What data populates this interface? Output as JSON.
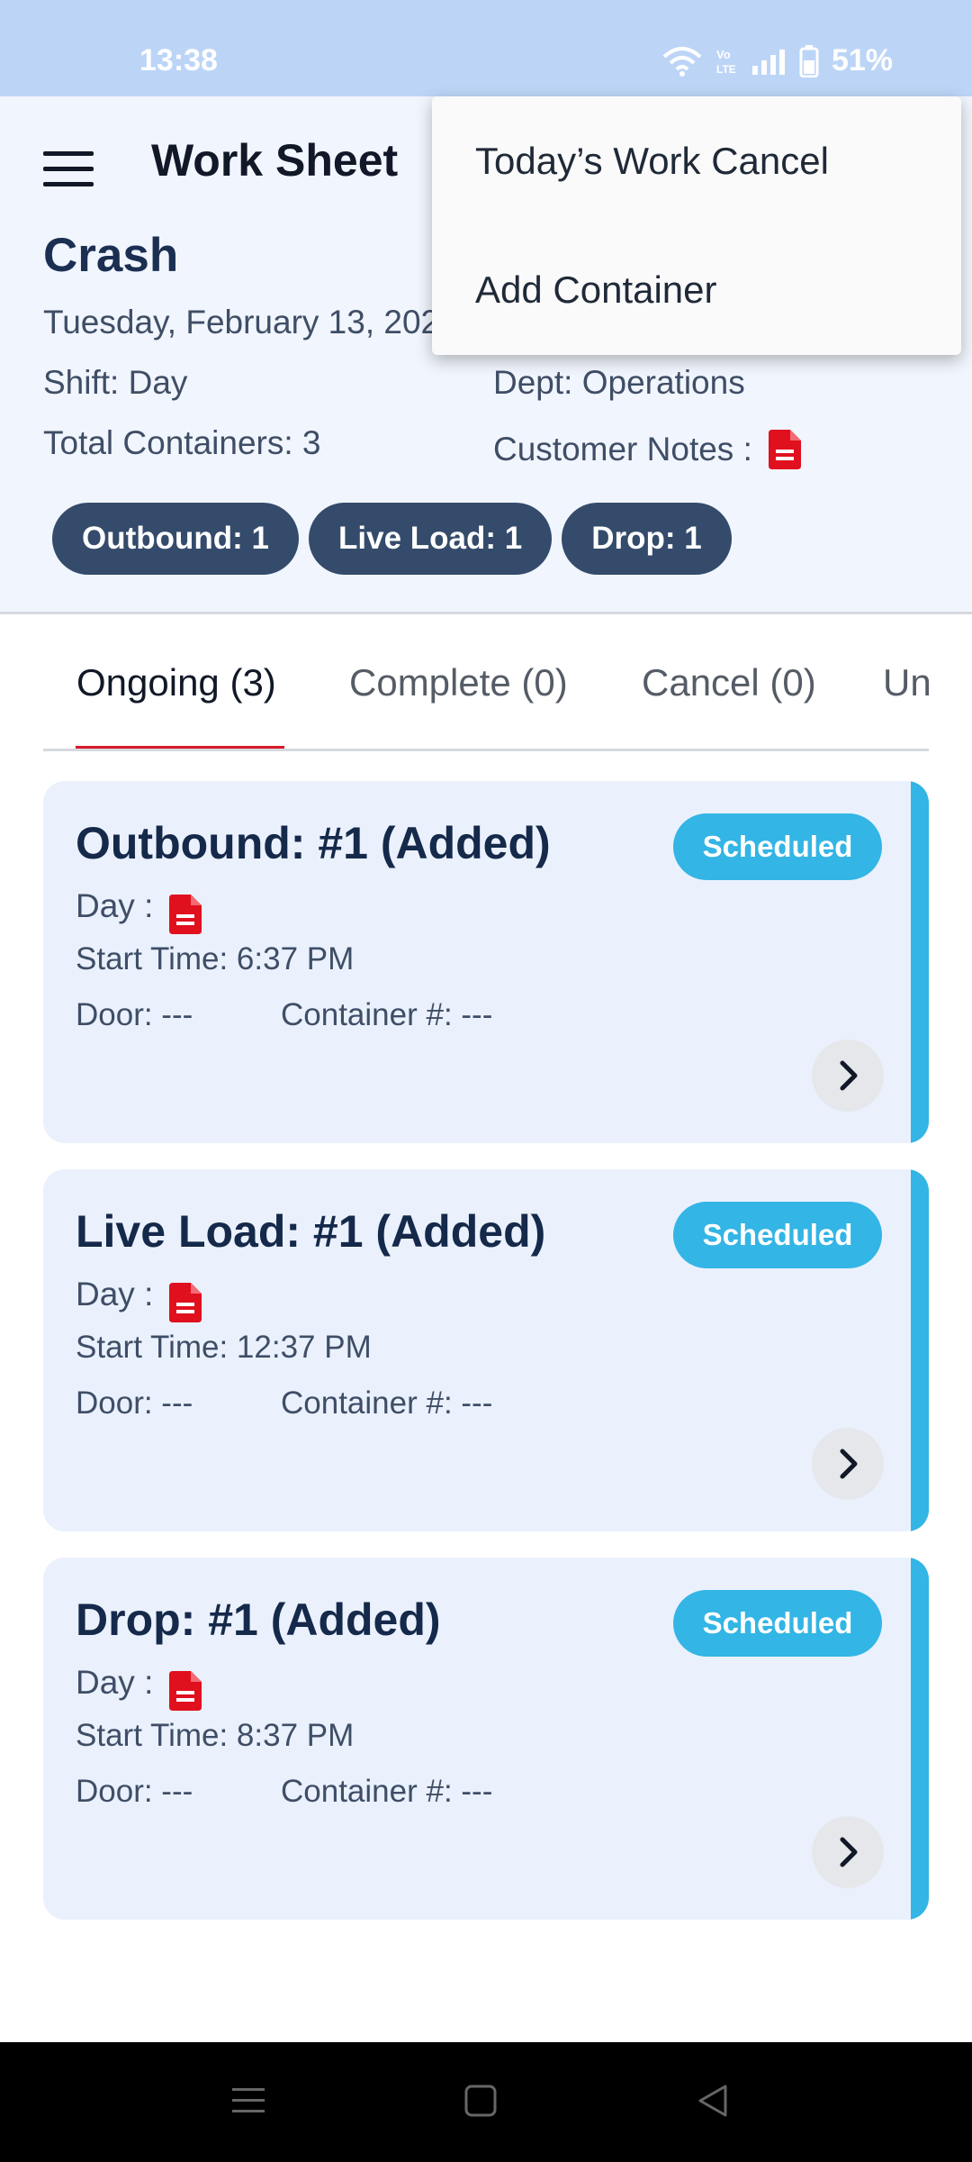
{
  "status_bar": {
    "time": "13:38",
    "battery": "51%",
    "icons": [
      "wifi-icon",
      "volte-icon",
      "signal-icon",
      "battery-icon"
    ]
  },
  "header": {
    "title": "Work Sheet",
    "menu_icon": "hamburger-menu-icon"
  },
  "dropdown": {
    "items": [
      {
        "label": "Today’s Work Cancel"
      },
      {
        "label": "Add Container"
      }
    ]
  },
  "summary": {
    "name": "Crash",
    "date": "Tuesday, February 13, 202",
    "shift": "Shift: Day",
    "total_containers": "Total Containers: 3",
    "dept": "Dept: Operations",
    "customer_notes_label": "Customer Notes :",
    "chips": [
      {
        "label": "Outbound: 1"
      },
      {
        "label": "Live Load: 1"
      },
      {
        "label": "Drop: 1"
      }
    ]
  },
  "tabs": [
    {
      "label": "Ongoing (3)"
    },
    {
      "label": "Complete (0)"
    },
    {
      "label": "Cancel (0)"
    },
    {
      "label": "Un"
    }
  ],
  "cards": [
    {
      "title": "Outbound: #1 (Added)",
      "status": "Scheduled",
      "day_label": "Day :",
      "start_time": "Start Time: 6:37 PM",
      "door": "Door: ---",
      "container": "Container #: ---"
    },
    {
      "title": "Live Load: #1 (Added)",
      "status": "Scheduled",
      "day_label": "Day :",
      "start_time": "Start Time: 12:37 PM",
      "door": "Door: ---",
      "container": "Container #: ---"
    },
    {
      "title": "Drop: #1 (Added)",
      "status": "Scheduled",
      "day_label": "Day :",
      "start_time": "Start Time: 8:37 PM",
      "door": "Door: ---",
      "container": "Container #: ---"
    }
  ],
  "colors": {
    "accent": "#33b5e5",
    "chip": "#344b6b",
    "tab_indicator": "#d81b2b",
    "note_icon": "#e0101e"
  }
}
